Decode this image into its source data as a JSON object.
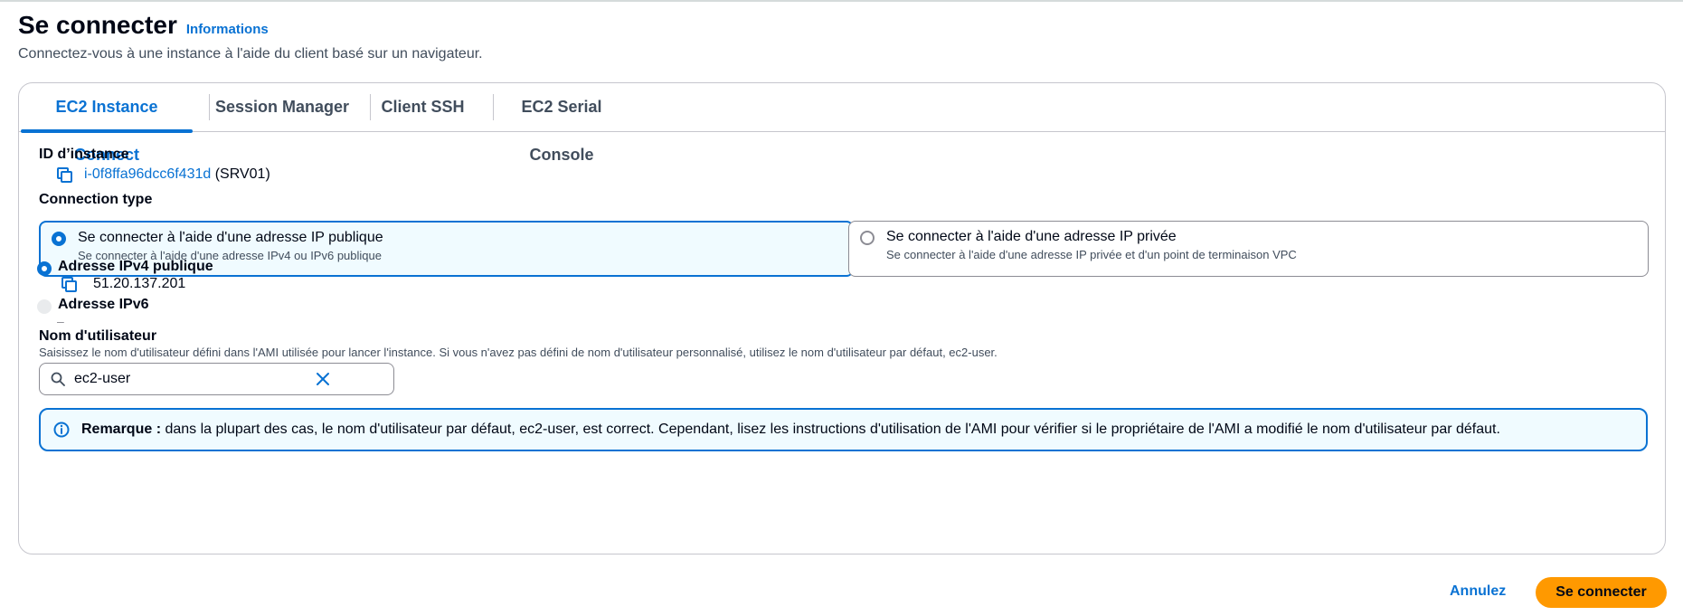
{
  "header": {
    "title": "Se connecter",
    "info_link": "Informations",
    "description": "Connectez-vous à une instance à l'aide du client basé sur un navigateur."
  },
  "tabs": [
    {
      "label": "EC2 Instance Connect",
      "active": true
    },
    {
      "label": "Session Manager",
      "active": false
    },
    {
      "label": "Client SSH",
      "active": false
    },
    {
      "label": "EC2 Serial Console",
      "active": false
    }
  ],
  "instance": {
    "label": "ID d’instance",
    "id": "i-0f8ffa96dcc6f431d",
    "name": "(SRV01)"
  },
  "connection_type": {
    "label": "Connection type",
    "options": [
      {
        "title": "Se connecter à l'aide d'une adresse IP publique",
        "description": "Se connecter à l'aide d'une adresse IPv4 ou IPv6 publique",
        "selected": true
      },
      {
        "title": "Se connecter à l'aide d'une adresse IP privée",
        "description": "Se connecter à l'aide d'une adresse IP privée et d'un point de terminaison VPC",
        "selected": false
      }
    ]
  },
  "ip_options": {
    "ipv4_label": "Adresse IPv4 publique",
    "ipv4_value": "51.20.137.201",
    "ipv6_label": "Adresse IPv6",
    "ipv6_value": "–"
  },
  "username": {
    "label": "Nom d'utilisateur",
    "description": "Saisissez le nom d'utilisateur défini dans l'AMI utilisée pour lancer l'instance. Si vous n'avez pas défini de nom d'utilisateur personnalisé, utilisez le nom d'utilisateur par défaut, ec2-user.",
    "value": "ec2-user"
  },
  "alert": {
    "bold": "Remarque :",
    "text": " dans la plupart des cas, le nom d'utilisateur par défaut, ec2-user, est correct. Cependant, lisez les instructions d'utilisation de l'AMI pour vérifier si le propriétaire de l'AMI a modifié le nom d'utilisateur par défaut."
  },
  "footer": {
    "cancel_label": "Annulez",
    "connect_label": "Se connecter"
  },
  "colors": {
    "accent": "#0972d3",
    "primary_button": "#ff9900",
    "selected_background": "#f0fbff"
  },
  "icons": {
    "copy": "copy-icon",
    "search": "search-icon",
    "clear": "close-icon",
    "info": "info-icon"
  }
}
